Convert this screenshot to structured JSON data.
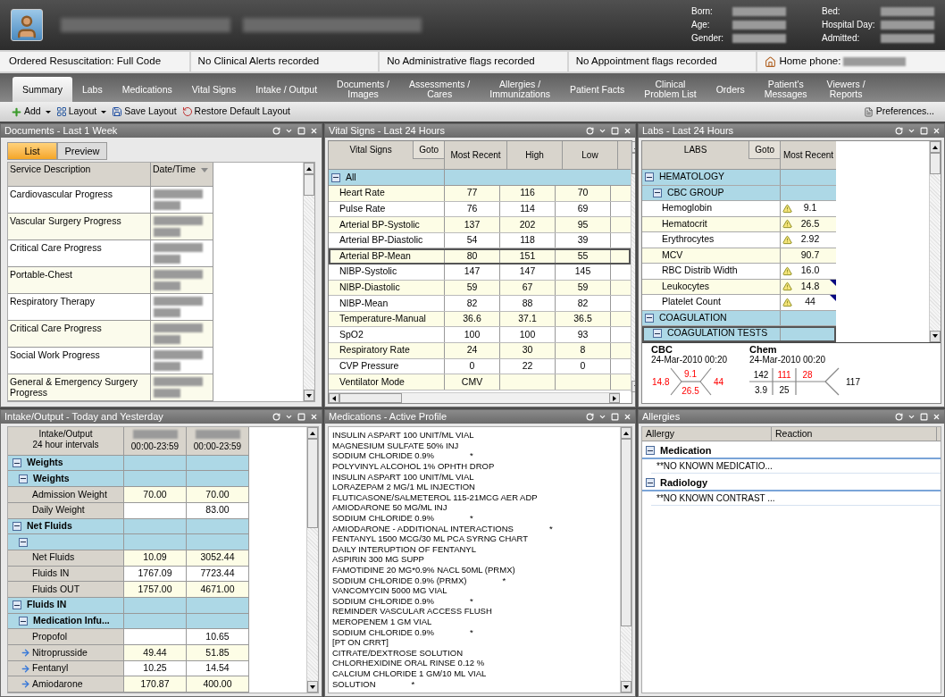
{
  "patient_header": {
    "labels_left": [
      "Born:",
      "Age:",
      "Gender:"
    ],
    "labels_right": [
      "Bed:",
      "Hospital Day:",
      "Admitted:"
    ]
  },
  "flags": [
    {
      "text": "Ordered Resuscitation: Full Code",
      "kind": "text"
    },
    {
      "text": "No Clinical Alerts recorded",
      "kind": "text"
    },
    {
      "text": "No Administrative flags recorded",
      "kind": "text"
    },
    {
      "text": "No Appointment flags recorded",
      "kind": "text"
    },
    {
      "text": "Home phone:",
      "kind": "phone"
    }
  ],
  "tabs": [
    {
      "label": "Summary",
      "selected": true
    },
    {
      "label": "Labs",
      "selected": false
    },
    {
      "label": "Medications",
      "selected": false
    },
    {
      "label": "Vital Signs",
      "selected": false
    },
    {
      "label": "Intake / Output",
      "selected": false
    },
    {
      "label": "Documents /\nImages",
      "selected": false
    },
    {
      "label": "Assessments /\nCares",
      "selected": false
    },
    {
      "label": "Allergies /\nImmunizations",
      "selected": false
    },
    {
      "label": "Patient Facts",
      "selected": false
    },
    {
      "label": "Clinical\nProblem List",
      "selected": false
    },
    {
      "label": "Orders",
      "selected": false
    },
    {
      "label": "Patient's\nMessages",
      "selected": false
    },
    {
      "label": "Viewers /\nReports",
      "selected": false
    }
  ],
  "toolbar": {
    "items": [
      {
        "label": "Add",
        "kind": "add",
        "menu": true
      },
      {
        "label": "Layout",
        "kind": "layout",
        "menu": true
      },
      {
        "label": "Save Layout",
        "kind": "save",
        "menu": false
      },
      {
        "label": "Restore Default Layout",
        "kind": "restore",
        "menu": false
      }
    ],
    "preferences": "Preferences..."
  },
  "documents": {
    "title": "Documents - Last 1 Week",
    "tabs": [
      {
        "label": "List",
        "selected": true
      },
      {
        "label": "Preview",
        "selected": false
      }
    ],
    "columns": [
      "Service Description",
      "Date/Time"
    ],
    "rows": [
      "Cardiovascular Progress",
      "Vascular Surgery Progress",
      "Critical Care Progress",
      "Portable-Chest",
      "Respiratory Therapy",
      "Critical Care Progress",
      "Social Work Progress",
      "General & Emergency Surgery Progress"
    ]
  },
  "vitals": {
    "title": "Vital Signs - Last 24 Hours",
    "columns": [
      "Vital Signs",
      "Goto",
      "Most Recent",
      "High",
      "Low"
    ],
    "group": "All",
    "rows": [
      {
        "name": "Heart Rate",
        "recent": "77",
        "high": "116",
        "low": "70",
        "selected": false
      },
      {
        "name": "Pulse Rate",
        "recent": "76",
        "high": "114",
        "low": "69",
        "selected": false
      },
      {
        "name": "Arterial BP-Systolic",
        "recent": "137",
        "high": "202",
        "low": "95",
        "selected": false
      },
      {
        "name": "Arterial BP-Diastolic",
        "recent": "54",
        "high": "118",
        "low": "39",
        "selected": false
      },
      {
        "name": "Arterial BP-Mean",
        "recent": "80",
        "high": "151",
        "low": "55",
        "selected": true
      },
      {
        "name": "NIBP-Systolic",
        "recent": "147",
        "high": "147",
        "low": "145",
        "selected": false
      },
      {
        "name": "NIBP-Diastolic",
        "recent": "59",
        "high": "67",
        "low": "59",
        "selected": false
      },
      {
        "name": "NIBP-Mean",
        "recent": "82",
        "high": "88",
        "low": "82",
        "selected": false
      },
      {
        "name": "Temperature-Manual",
        "recent": "36.6",
        "high": "37.1",
        "low": "36.5",
        "selected": false
      },
      {
        "name": "SpO2",
        "recent": "100",
        "high": "100",
        "low": "93",
        "selected": false
      },
      {
        "name": "Respiratory Rate",
        "recent": "24",
        "high": "30",
        "low": "8",
        "selected": false
      },
      {
        "name": "CVP Pressure",
        "recent": "0",
        "high": "22",
        "low": "0",
        "selected": false
      },
      {
        "name": "Ventilator Mode",
        "recent": "CMV",
        "selected": false
      }
    ]
  },
  "labs": {
    "title": "Labs - Last 24 Hours",
    "columns": [
      "LABS",
      "Goto",
      "Most Recent"
    ],
    "rows": [
      {
        "kind": "group",
        "label": "HEMATOLOGY",
        "selected": false
      },
      {
        "kind": "subgroup",
        "label": "CBC GROUP",
        "selected": false
      },
      {
        "kind": "item",
        "label": "Hemoglobin",
        "value": "9.1",
        "abnormal": true,
        "comment": false,
        "selected": false
      },
      {
        "kind": "item",
        "label": "Hematocrit",
        "value": "26.5",
        "abnormal": true,
        "comment": false,
        "selected": false
      },
      {
        "kind": "item",
        "label": "Erythrocytes",
        "value": "2.92",
        "abnormal": true,
        "comment": false,
        "selected": false
      },
      {
        "kind": "item",
        "label": "MCV",
        "value": "90.7",
        "abnormal": false,
        "comment": false,
        "selected": false
      },
      {
        "kind": "item",
        "label": "RBC Distrib Width",
        "value": "16.0",
        "abnormal": true,
        "comment": false,
        "selected": false
      },
      {
        "kind": "item",
        "label": "Leukocytes",
        "value": "14.8",
        "abnormal": true,
        "comment": true,
        "selected": false
      },
      {
        "kind": "item",
        "label": "Platelet Count",
        "value": "44",
        "abnormal": true,
        "comment": true,
        "selected": false
      },
      {
        "kind": "group",
        "label": "COAGULATION",
        "selected": false
      },
      {
        "kind": "subgroup",
        "label": "COAGULATION TESTS",
        "selected": true
      }
    ],
    "cbc": {
      "title": "CBC",
      "date": "24-Mar-2010 00:20",
      "left": {
        "text": "14.8",
        "abnormal": true
      },
      "top": {
        "text": "9.1",
        "abnormal": true
      },
      "bottom": {
        "text": "26.5",
        "abnormal": true
      },
      "right": {
        "text": "44",
        "abnormal": true
      }
    },
    "chem": {
      "title": "Chem",
      "date": "24-Mar-2010 00:20",
      "top": [
        {
          "text": "142",
          "abnormal": false
        },
        {
          "text": "111",
          "abnormal": true
        },
        {
          "text": "28",
          "abnormal": true
        }
      ],
      "bottom": [
        {
          "text": "3.9",
          "abnormal": false
        },
        {
          "text": "25",
          "abnormal": false
        }
      ],
      "right": {
        "text": "117",
        "abnormal": false
      }
    }
  },
  "intake": {
    "title": "Intake/Output - Today and Yesterday",
    "header": "Intake/Output\n24 hour intervals",
    "times": [
      "00:00-23:59",
      "00:00-23:59"
    ],
    "rows": [
      {
        "kind": "group",
        "label": "Weights"
      },
      {
        "kind": "subgroup",
        "label": "Weights"
      },
      {
        "kind": "item",
        "label": "Admission Weight",
        "value_1": "70.00",
        "value_2": "70.00",
        "arrow": false
      },
      {
        "kind": "item",
        "label": "Daily Weight",
        "value_2": "83.00",
        "arrow": false
      },
      {
        "kind": "group",
        "label": "Net Fluids"
      },
      {
        "kind": "subgroup"
      },
      {
        "kind": "item",
        "label": "Net Fluids",
        "value_1": "10.09",
        "value_2": "3052.44",
        "arrow": false
      },
      {
        "kind": "item",
        "label": "Fluids IN",
        "value_1": "1767.09",
        "value_2": "7723.44",
        "arrow": false
      },
      {
        "kind": "item",
        "label": "Fluids OUT",
        "value_1": "1757.00",
        "value_2": "4671.00",
        "arrow": false
      },
      {
        "kind": "group",
        "label": "Fluids IN"
      },
      {
        "kind": "subgroup",
        "label": "Medication Infu..."
      },
      {
        "kind": "item",
        "label": "Propofol",
        "value_2": "10.65",
        "arrow": false
      },
      {
        "kind": "item",
        "label": "Nitroprusside",
        "value_1": "49.44",
        "value_2": "51.85",
        "arrow": true
      },
      {
        "kind": "item",
        "label": "Fentanyl",
        "value_1": "10.25",
        "value_2": "14.54",
        "arrow": true
      },
      {
        "kind": "item",
        "label": "Amiodarone",
        "value_1": "170.87",
        "value_2": "400.00",
        "arrow": true
      }
    ]
  },
  "medications": {
    "title": "Medications - Active Profile",
    "items": [
      {
        "name": "INSULIN ASPART 100 UNIT/ML VIAL"
      },
      {
        "name": "MAGNESIUM SULFATE 50% INJ"
      },
      {
        "name": "SODIUM CHLORIDE 0.9%",
        "note": "*"
      },
      {
        "name": "POLYVINYL ALCOHOL 1% OPHTH DROP"
      },
      {
        "name": "INSULIN ASPART 100 UNIT/ML VIAL"
      },
      {
        "name": "LORAZEPAM 2 MG/1 ML INJECTION"
      },
      {
        "name": "FLUTICASONE/SALMETEROL 115-21MCG AER ADP"
      },
      {
        "name": "AMIODARONE 50 MG/ML INJ"
      },
      {
        "name": "SODIUM CHLORIDE 0.9%",
        "note": "*"
      },
      {
        "name": "AMIODARONE - ADDITIONAL INTERACTIONS",
        "note": "*"
      },
      {
        "name": "FENTANYL 1500 MCG/30 ML PCA SYRNG CHART"
      },
      {
        "name": "DAILY INTERUPTION OF FENTANYL"
      },
      {
        "name": "ASPIRIN 300 MG SUPP"
      },
      {
        "name": "FAMOTIDINE 20 MG*0.9% NACL 50ML (PRMX)"
      },
      {
        "name": "SODIUM CHLORIDE 0.9% (PRMX)",
        "note": "*"
      },
      {
        "name": "VANCOMYCIN 5000 MG VIAL"
      },
      {
        "name": "SODIUM CHLORIDE 0.9%",
        "note": "*"
      },
      {
        "name": "REMINDER VASCULAR ACCESS FLUSH"
      },
      {
        "name": "MEROPENEM 1 GM VIAL"
      },
      {
        "name": "SODIUM CHLORIDE 0.9%",
        "note": "*"
      },
      {
        "name": "[PT ON CRRT]"
      },
      {
        "name": "CITRATE/DEXTROSE SOLUTION"
      },
      {
        "name": "CHLORHEXIDINE ORAL RINSE 0.12 %"
      },
      {
        "name": "CALCIUM CHLORIDE 1 GM/10 ML VIAL"
      },
      {
        "name": "SOLUTION",
        "note": "*"
      }
    ]
  },
  "allergies": {
    "title": "Allergies",
    "columns": [
      "Allergy",
      "Reaction"
    ],
    "groups": [
      {
        "label": "Medication",
        "items": [
          "**NO KNOWN MEDICATIO..."
        ]
      },
      {
        "label": "Radiology",
        "items": [
          "**NO KNOWN CONTRAST ..."
        ]
      }
    ]
  }
}
